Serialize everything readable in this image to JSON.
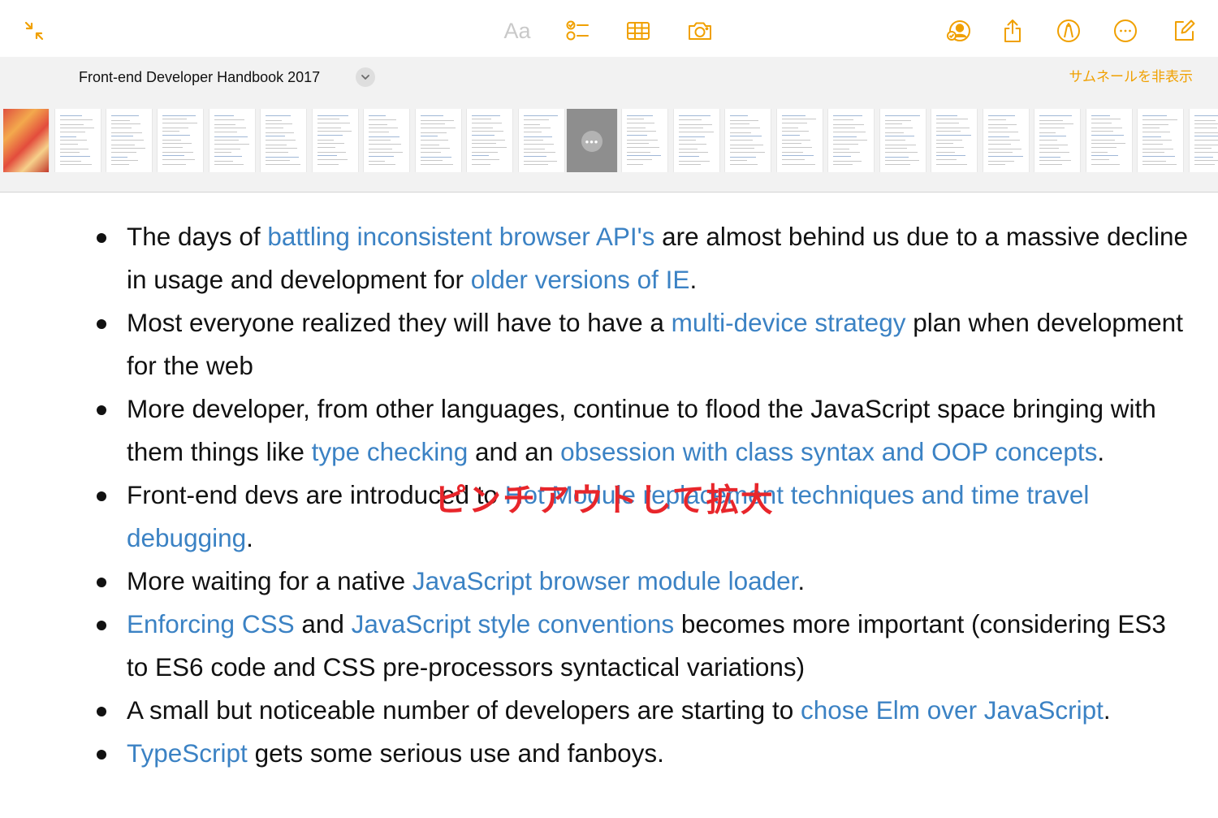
{
  "toolbar": {
    "collapse_icon": "collapse-arrows-icon",
    "format_label": "Aa",
    "checklist_icon": "checklist-icon",
    "table_icon": "table-icon",
    "camera_icon": "camera-icon",
    "collaborate_icon": "collaborate-icon",
    "share_icon": "share-icon",
    "markup_icon": "markup-pen-icon",
    "more_icon": "ellipsis-circle-icon",
    "compose_icon": "compose-icon",
    "accent_color": "#f0a000"
  },
  "document": {
    "title": "Front-end Developer Handbook 2017",
    "hide_thumbnails": "サムネールを非表示"
  },
  "annotation": "ピンチアウトして拡大",
  "bullets": [
    [
      {
        "t": "The days of "
      },
      {
        "t": "battling inconsistent browser API's",
        "link": true
      },
      {
        "t": " are almost behind us due to a massive decline in usage and development for "
      },
      {
        "t": "older versions of IE",
        "link": true
      },
      {
        "t": "."
      }
    ],
    [
      {
        "t": "Most everyone realized they will have to have a "
      },
      {
        "t": "multi-device strategy",
        "link": true
      },
      {
        "t": " plan when development for the web"
      }
    ],
    [
      {
        "t": "More developer, from other languages, continue to flood the JavaScript space bringing with them things like "
      },
      {
        "t": "type checking",
        "link": true
      },
      {
        "t": " and an "
      },
      {
        "t": "obsession with class syntax and OOP concepts",
        "link": true
      },
      {
        "t": "."
      }
    ],
    [
      {
        "t": "Front-end devs are introduced to "
      },
      {
        "t": "Hot Module replacement techniques and time travel debugging",
        "link": true
      },
      {
        "t": "."
      }
    ],
    [
      {
        "t": "More waiting for a native "
      },
      {
        "t": "JavaScript browser module loader",
        "link": true
      },
      {
        "t": "."
      }
    ],
    [
      {
        "t": "Enforcing CSS",
        "link": true
      },
      {
        "t": " and "
      },
      {
        "t": "JavaScript style conventions",
        "link": true
      },
      {
        "t": " becomes more important (considering ES3 to ES6 code and CSS pre-processors syntactical variations)"
      }
    ],
    [
      {
        "t": "A small but noticeable number of developers are starting to "
      },
      {
        "t": "chose Elm over JavaScript",
        "link": true
      },
      {
        "t": "."
      }
    ],
    [
      {
        "t": "TypeScript",
        "link": true
      },
      {
        "t": " gets some serious use and fanboys."
      }
    ]
  ],
  "colors": {
    "link": "#3b82c4",
    "annotation": "#e8262b",
    "strip_background": "#f2f2f2"
  }
}
